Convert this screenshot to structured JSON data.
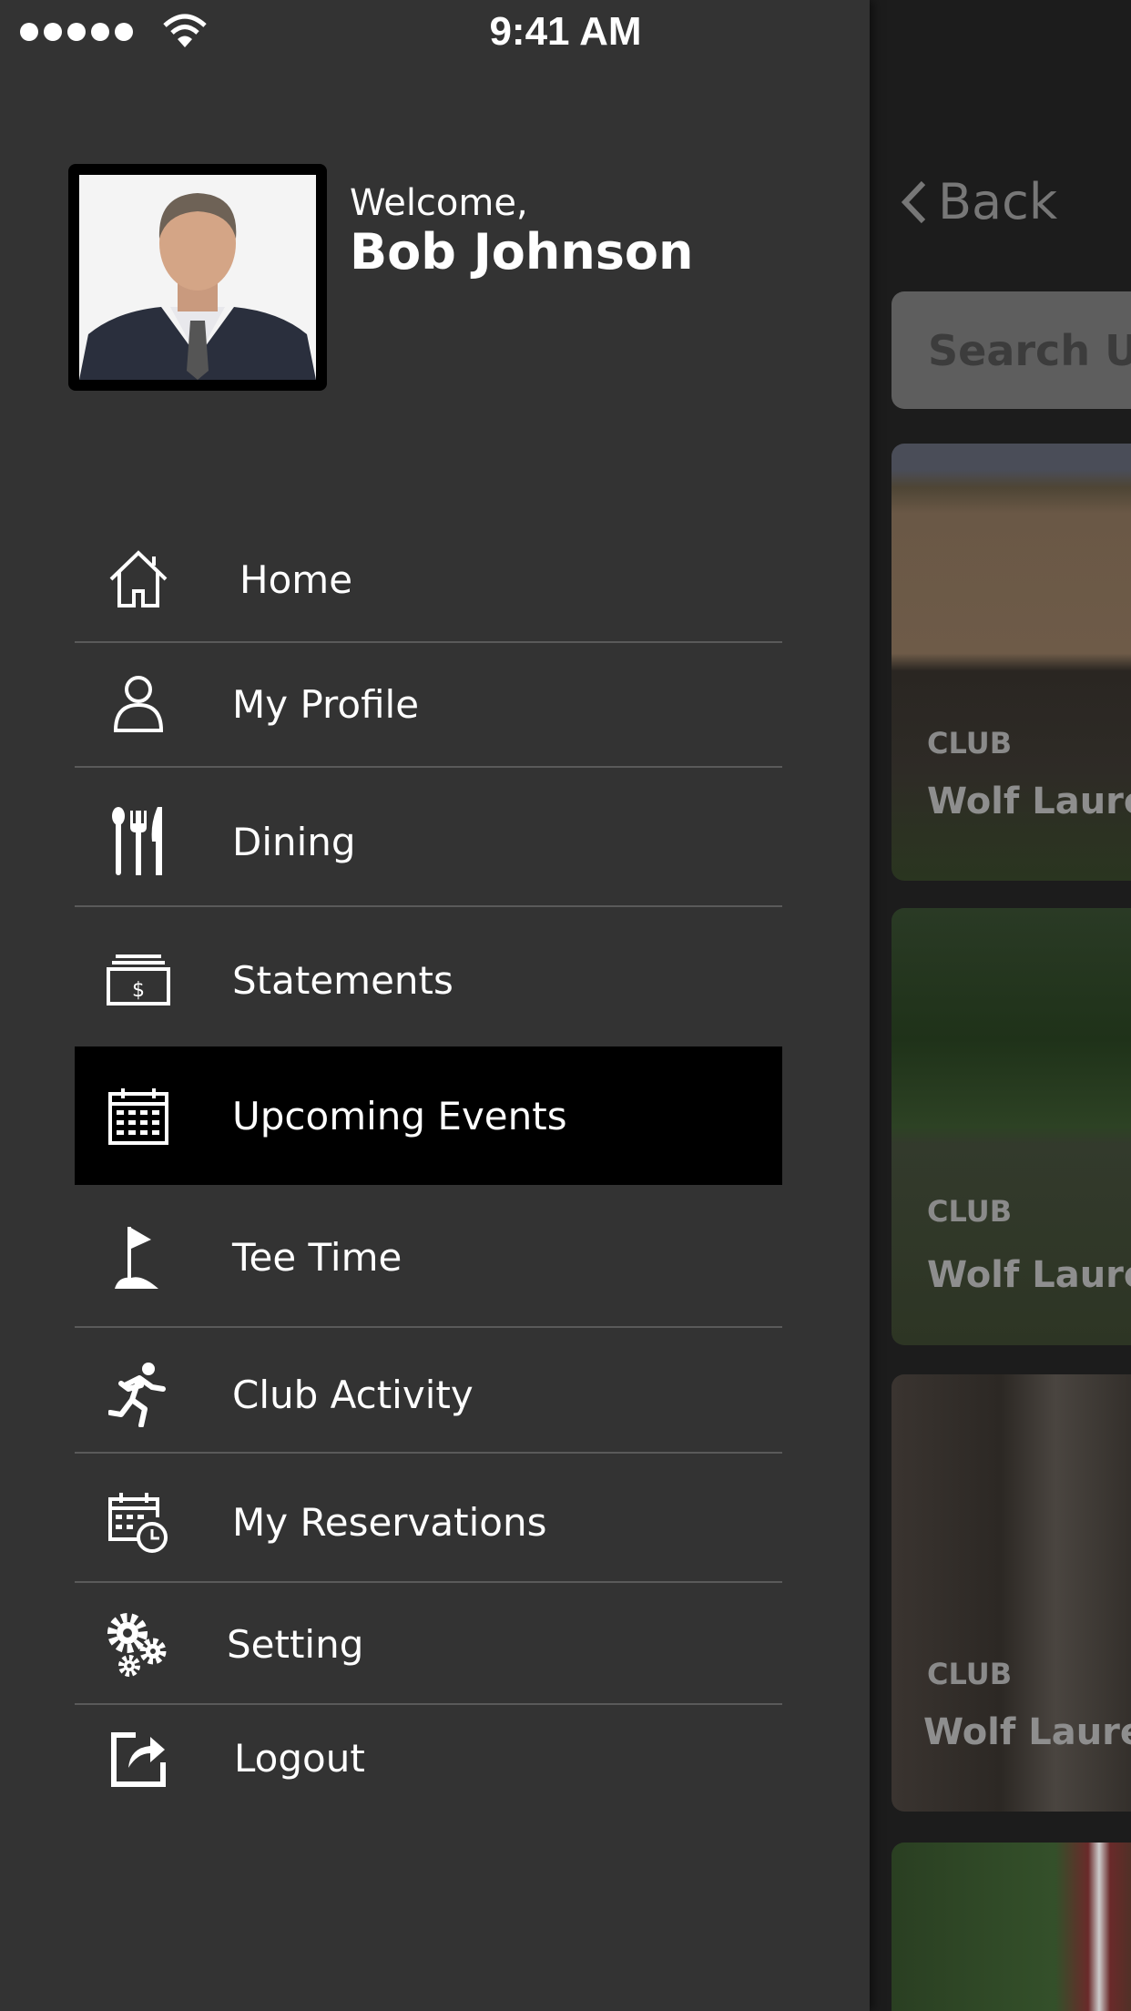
{
  "status_bar": {
    "time": "9:41 AM",
    "signal_icon": "signal-dots-icon",
    "wifi_icon": "wifi-icon"
  },
  "drawer": {
    "welcome": "Welcome,",
    "user_name": "Bob Johnson",
    "selected": "Upcoming Events",
    "items": [
      {
        "label": "Home",
        "icon": "home-icon"
      },
      {
        "label": "My Profile",
        "icon": "user-icon"
      },
      {
        "label": "Dining",
        "icon": "cutlery-icon"
      },
      {
        "label": "Statements",
        "icon": "statement-icon"
      },
      {
        "label": "Upcoming Events",
        "icon": "calendar-icon"
      },
      {
        "label": "Tee Time",
        "icon": "golf-flag-icon"
      },
      {
        "label": "Club Activity",
        "icon": "running-icon"
      },
      {
        "label": "My Reservations",
        "icon": "calendar-clock-icon"
      },
      {
        "label": "Setting",
        "icon": "gears-icon"
      },
      {
        "label": "Logout",
        "icon": "logout-icon"
      }
    ]
  },
  "main": {
    "back_label": "Back",
    "search_placeholder": "Search Up",
    "cards": [
      {
        "category": "CLUB",
        "title": "Wolf Laure"
      },
      {
        "category": "CLUB",
        "title": "Wolf Laure"
      },
      {
        "category": "CLUB",
        "title": "Wolf Laurel"
      }
    ]
  },
  "colors": {
    "drawer_bg": "#333333",
    "selected_bg": "#000000",
    "main_bg": "#1c1c1c"
  }
}
